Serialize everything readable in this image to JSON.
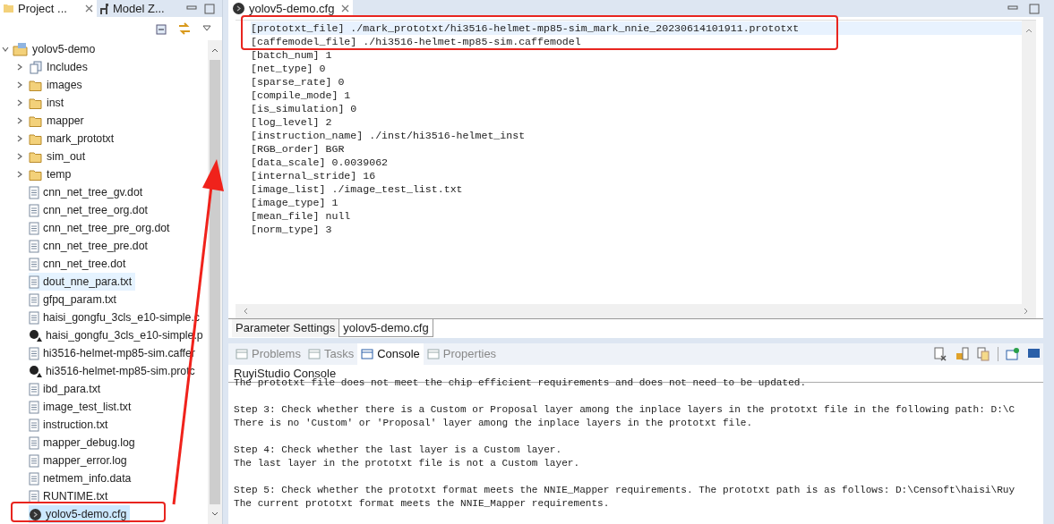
{
  "left_panel": {
    "tabs": [
      {
        "label": "Project ...",
        "selected": true
      },
      {
        "label": "Model Z...",
        "selected": false
      }
    ],
    "tree": {
      "label": "yolov5-demo",
      "expanded": true,
      "children": [
        {
          "label": "Includes",
          "kind": "includes",
          "expanded": false,
          "selected": false,
          "hovered": false
        },
        {
          "label": "images",
          "kind": "folder",
          "expanded": false,
          "selected": false,
          "hovered": false
        },
        {
          "label": "inst",
          "kind": "folder",
          "expanded": false,
          "selected": false,
          "hovered": false
        },
        {
          "label": "mapper",
          "kind": "folder",
          "expanded": false,
          "selected": false,
          "hovered": false
        },
        {
          "label": "mark_prototxt",
          "kind": "folder",
          "expanded": false,
          "selected": false,
          "hovered": false
        },
        {
          "label": "sim_out",
          "kind": "folder",
          "expanded": false,
          "selected": false,
          "hovered": false
        },
        {
          "label": "temp",
          "kind": "folder",
          "expanded": false,
          "selected": false,
          "hovered": false
        },
        {
          "label": "cnn_net_tree_gv.dot",
          "kind": "file",
          "selected": false,
          "hovered": false
        },
        {
          "label": "cnn_net_tree_org.dot",
          "kind": "file",
          "selected": false,
          "hovered": false
        },
        {
          "label": "cnn_net_tree_pre_org.dot",
          "kind": "file",
          "selected": false,
          "hovered": false
        },
        {
          "label": "cnn_net_tree_pre.dot",
          "kind": "file",
          "selected": false,
          "hovered": false
        },
        {
          "label": "cnn_net_tree.dot",
          "kind": "file",
          "selected": false,
          "hovered": false
        },
        {
          "label": "dout_nne_para.txt",
          "kind": "file",
          "selected": false,
          "hovered": true
        },
        {
          "label": "gfpq_param.txt",
          "kind": "file",
          "selected": false,
          "hovered": false
        },
        {
          "label": "haisi_gongfu_3cls_e10-simple.c",
          "kind": "file",
          "selected": false,
          "hovered": false
        },
        {
          "label": "haisi_gongfu_3cls_e10-simple.p",
          "kind": "model",
          "selected": false,
          "hovered": false
        },
        {
          "label": "hi3516-helmet-mp85-sim.caffer",
          "kind": "file",
          "selected": false,
          "hovered": false
        },
        {
          "label": "hi3516-helmet-mp85-sim.protc",
          "kind": "model",
          "selected": false,
          "hovered": false
        },
        {
          "label": "ibd_para.txt",
          "kind": "file",
          "selected": false,
          "hovered": false
        },
        {
          "label": "image_test_list.txt",
          "kind": "file",
          "selected": false,
          "hovered": false
        },
        {
          "label": "instruction.txt",
          "kind": "file",
          "selected": false,
          "hovered": false
        },
        {
          "label": "mapper_debug.log",
          "kind": "file",
          "selected": false,
          "hovered": false
        },
        {
          "label": "mapper_error.log",
          "kind": "file",
          "selected": false,
          "hovered": false
        },
        {
          "label": "netmem_info.data",
          "kind": "file",
          "selected": false,
          "hovered": false
        },
        {
          "label": "RUNTIME.txt",
          "kind": "file",
          "selected": false,
          "hovered": false
        },
        {
          "label": "yolov5-demo.cfg",
          "kind": "cfg",
          "selected": true,
          "hovered": false
        }
      ]
    }
  },
  "editor": {
    "tab": "yolov5-demo.cfg",
    "lines": [
      "[prototxt_file] ./mark_prototxt/hi3516-helmet-mp85-sim_mark_nnie_20230614101911.prototxt",
      "[caffemodel_file] ./hi3516-helmet-mp85-sim.caffemodel",
      "[batch_num] 1",
      "[net_type] 0",
      "[sparse_rate] 0",
      "[compile_mode] 1",
      "[is_simulation] 0",
      "[log_level] 2",
      "[instruction_name] ./inst/hi3516-helmet_inst",
      "[RGB_order] BGR",
      "[data_scale] 0.0039062",
      "[internal_stride] 16",
      "[image_list] ./image_test_list.txt",
      "[image_type] 1",
      "[mean_file] null",
      "[norm_type] 3"
    ],
    "bottom_tabs": [
      {
        "label": "Parameter Settings",
        "selected": false
      },
      {
        "label": "yolov5-demo.cfg",
        "selected": true
      }
    ]
  },
  "console": {
    "tabs": [
      {
        "label": "Problems",
        "selected": false
      },
      {
        "label": "Tasks",
        "selected": false
      },
      {
        "label": "Console",
        "selected": true
      },
      {
        "label": "Properties",
        "selected": false
      }
    ],
    "title": "RuyiStudio Console",
    "paragraphs": [
      [
        "The prototxt file does not meet the chip efficient requirements and does not need to be updated."
      ],
      [
        "Step 3: Check whether there is a Custom or Proposal layer among the inplace layers in the prototxt file in the following path: D:\\C",
        "There is no 'Custom' or 'Proposal' layer among the inplace layers in the prototxt file."
      ],
      [
        "Step 4: Check whether the last layer is a Custom layer.",
        "The last layer in the prototxt file is not a Custom layer."
      ],
      [
        "Step 5: Check whether the prototxt format meets the NNIE_Mapper requirements. The prototxt path is as follows: D:\\Censoft\\haisi\\Ruy",
        "The current prototxt format meets the NNIE_Mapper requirements."
      ]
    ]
  }
}
